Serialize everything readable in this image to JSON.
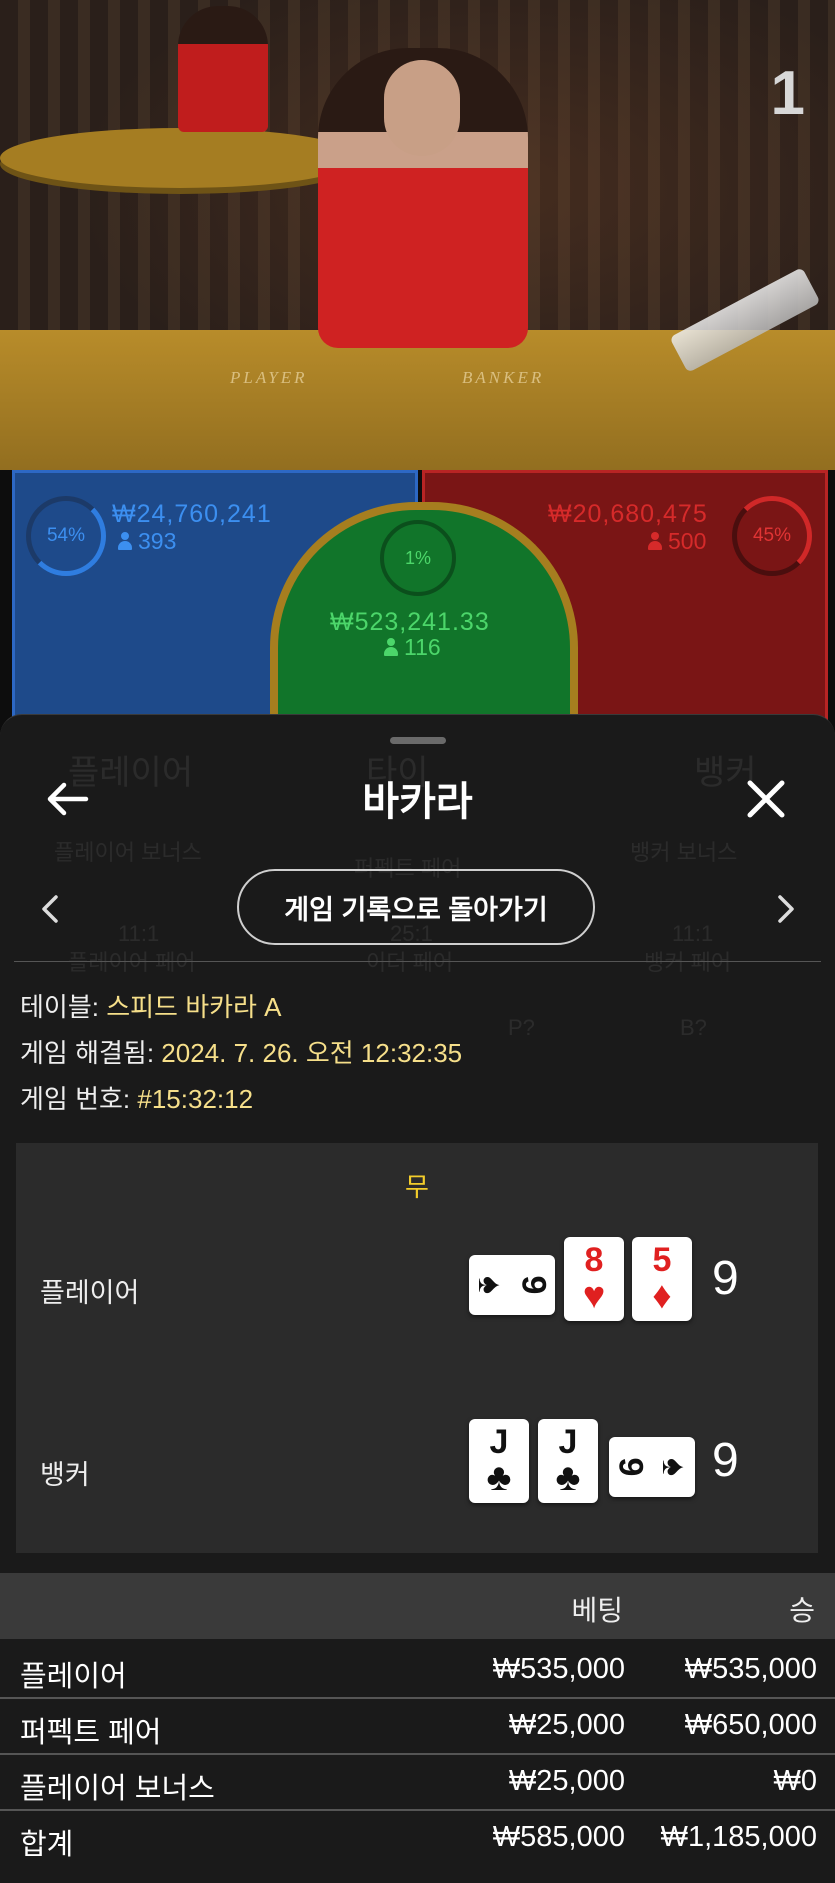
{
  "stream": {
    "round_indicator": "1",
    "table_labels": [
      "PLAYER",
      "BANKER"
    ]
  },
  "betting_zones": {
    "player": {
      "percent": "54%",
      "amount": "₩24,760,241",
      "players": "393",
      "color": "#2f7de0"
    },
    "tie": {
      "percent": "1%",
      "amount": "₩523,241.33",
      "players": "116",
      "color": "#4cd66a"
    },
    "banker": {
      "percent": "45%",
      "amount": "₩20,680,475",
      "players": "500",
      "color": "#d62a2a"
    }
  },
  "background_ghost": {
    "tabs": [
      "플레이어",
      "타이",
      "뱅커"
    ],
    "side_bets": [
      "플레이어 보너스",
      "퍼펙트 페어",
      "뱅커 보너스"
    ],
    "pair_odds": [
      "11:1",
      "25:1",
      "11:1"
    ],
    "pair_labels": [
      "플레이어 페어",
      "이더 페어",
      "뱅커 페어"
    ],
    "predictions": [
      "P?",
      "B?"
    ]
  },
  "sheet": {
    "title": "바카라",
    "back_icon": "arrow-left-icon",
    "close_icon": "close-icon",
    "return_button": "게임 기록으로 돌아가기",
    "info": {
      "table_label": "테이블:",
      "table_value": "스피드 바카라 A",
      "resolved_label": "게임 해결됨:",
      "resolved_value": "2024. 7. 26. 오전 12:32:35",
      "game_no_label": "게임 번호:",
      "game_no_value": "#15:32:12"
    },
    "result": {
      "outcome": "무",
      "player": {
        "label": "플레이어",
        "score": "9",
        "cards": [
          {
            "rank": "9",
            "suit": "♠",
            "color": "black",
            "rotated": true
          },
          {
            "rank": "8",
            "suit": "♥",
            "color": "red",
            "rotated": false
          },
          {
            "rank": "5",
            "suit": "♦",
            "color": "red",
            "rotated": false
          }
        ]
      },
      "banker": {
        "label": "뱅커",
        "score": "9",
        "cards": [
          {
            "rank": "J",
            "suit": "♣",
            "color": "black",
            "rotated": false
          },
          {
            "rank": "J",
            "suit": "♣",
            "color": "black",
            "rotated": false
          },
          {
            "rank": "9",
            "suit": "♠",
            "color": "black",
            "rotated": true
          }
        ]
      }
    },
    "bets_table": {
      "headers": {
        "bet": "베팅",
        "win": "승"
      },
      "rows": [
        {
          "name": "플레이어",
          "bet": "₩535,000",
          "win": "₩535,000"
        },
        {
          "name": "퍼펙트 페어",
          "bet": "₩25,000",
          "win": "₩650,000"
        },
        {
          "name": "플레이어 보너스",
          "bet": "₩25,000",
          "win": "₩0"
        }
      ],
      "total": {
        "name": "합계",
        "bet": "₩585,000",
        "win": "₩1,185,000"
      }
    }
  }
}
